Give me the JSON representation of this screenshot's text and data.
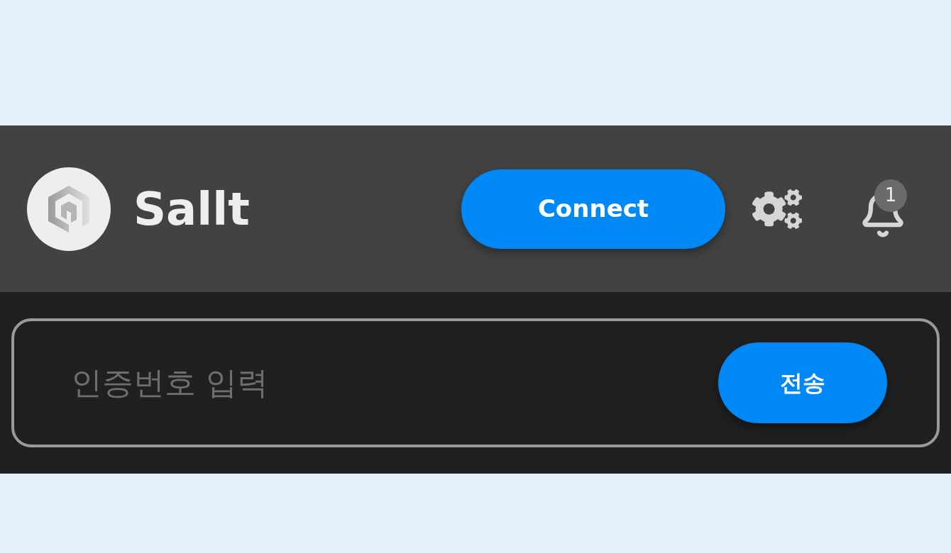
{
  "header": {
    "brand": "Sallt",
    "connect_button": "Connect",
    "notifications": {
      "count": "1"
    }
  },
  "verification": {
    "placeholder": "인증번호 입력",
    "send_button": "전송"
  }
}
